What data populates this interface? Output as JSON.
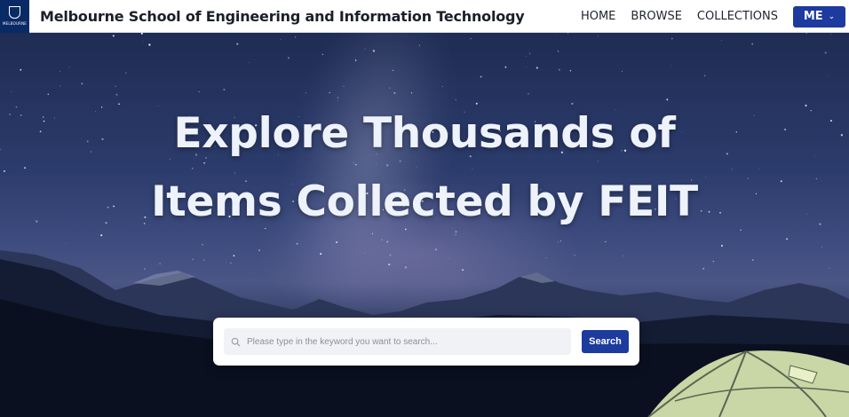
{
  "header": {
    "logo_text": "MELBOURNE",
    "title": "Melbourne School of Engineering and Information Technology",
    "nav": [
      {
        "label": "HOME"
      },
      {
        "label": "BROWSE"
      },
      {
        "label": "COLLECTIONS"
      }
    ],
    "account_button": {
      "label": "ME",
      "icon": "chevron-down-icon"
    }
  },
  "hero": {
    "headline_line1": "Explore Thousands of",
    "headline_line2": "Items Collected by FEIT"
  },
  "search": {
    "placeholder": "Please type in the keyword you want to search...",
    "value": "",
    "button_label": "Search",
    "icon": "search-icon"
  },
  "colors": {
    "brand_navy": "#0a2a66",
    "accent_blue": "#1d3a9e",
    "header_bg": "#ffffff"
  }
}
